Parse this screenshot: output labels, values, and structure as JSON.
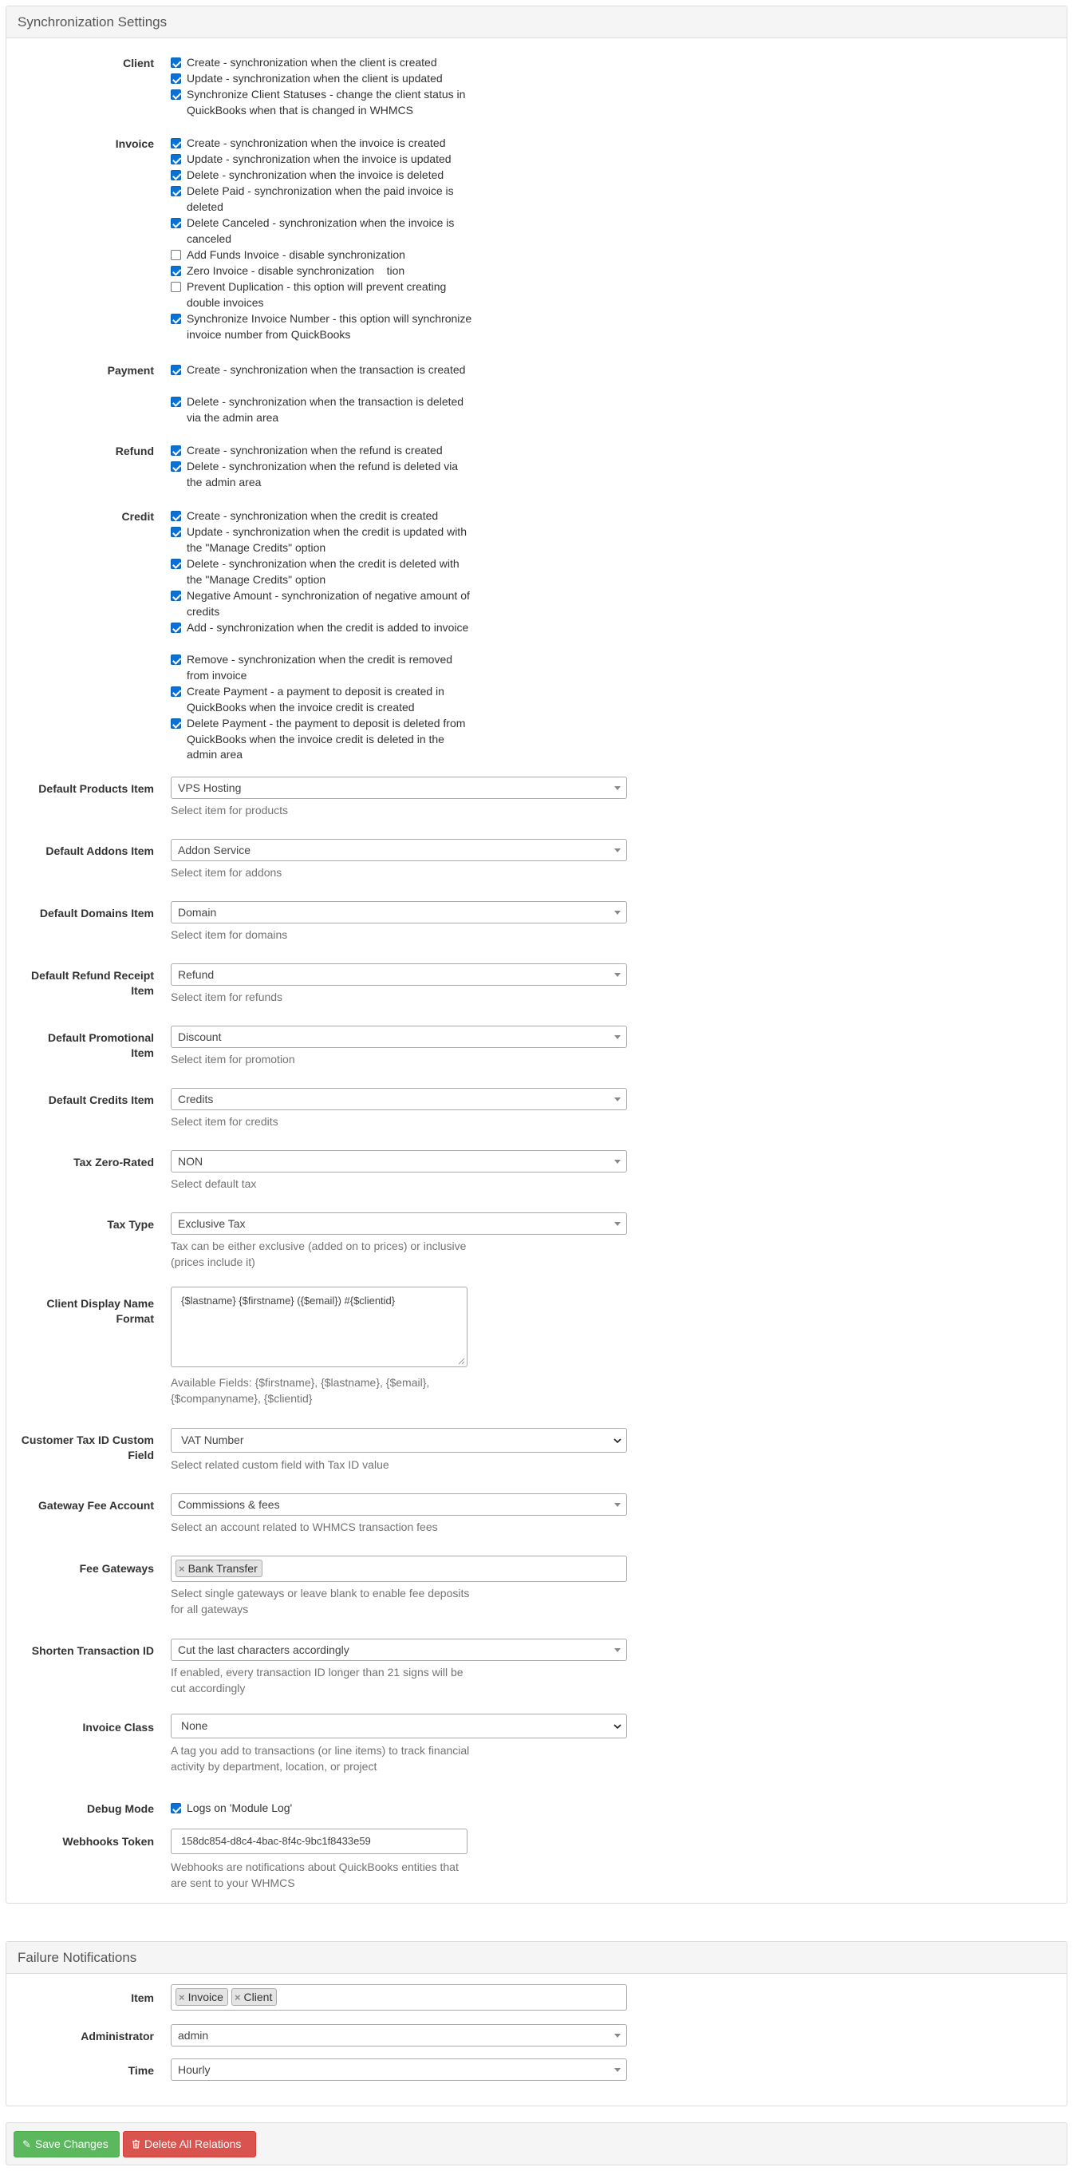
{
  "sync": {
    "title": "Synchronization Settings",
    "client": {
      "label": "Client",
      "items": [
        {
          "text": "Create - synchronization when the client is created",
          "checked": true
        },
        {
          "text": "Update - synchronization when the client is updated",
          "checked": true
        },
        {
          "text": "Synchronize Client Statuses - change the client status in QuickBooks when that is changed in WHMCS",
          "checked": true
        }
      ]
    },
    "invoice": {
      "label": "Invoice",
      "items": [
        {
          "text": "Create - synchronization when the invoice is created",
          "checked": true
        },
        {
          "text": "Update - synchronization when the invoice is updated",
          "checked": true
        },
        {
          "text": "Delete - synchronization when the invoice is deleted",
          "checked": true
        },
        {
          "text": "Delete Paid - synchronization when the paid invoice is deleted",
          "checked": true
        },
        {
          "text": "Delete Canceled - synchronization when the invoice is canceled",
          "checked": true
        },
        {
          "text": "Add Funds Invoice - disable synchronization",
          "checked": false
        },
        {
          "text": "Zero Invoice - disable synchronization    tion",
          "checked": true
        },
        {
          "text": "Prevent Duplication - this option will prevent creating double invoices",
          "checked": false
        },
        {
          "text": "Synchronize Invoice Number - this option will synchronize invoice number from QuickBooks",
          "checked": true
        }
      ]
    },
    "payment": {
      "label": "Payment",
      "items": [
        {
          "text": "Create - synchronization when the transaction is created",
          "checked": true
        },
        {
          "text": "Delete - synchronization when the transaction is deleted via the admin area",
          "checked": true
        }
      ]
    },
    "refund": {
      "label": "Refund",
      "items": [
        {
          "text": "Create - synchronization when the refund is created",
          "checked": true
        },
        {
          "text": "Delete - synchronization when the refund is deleted via the admin area",
          "checked": true
        }
      ]
    },
    "credit": {
      "label": "Credit",
      "items": [
        {
          "text": "Create - synchronization when the credit is created",
          "checked": true
        },
        {
          "text": "Update - synchronization when the credit is updated with the \"Manage Credits\" option",
          "checked": true
        },
        {
          "text": "Delete - synchronization when the credit is deleted with the \"Manage Credits\" option",
          "checked": true
        },
        {
          "text": "Negative Amount - synchronization of negative amount of credits",
          "checked": true
        },
        {
          "text": "Add - synchronization when the credit is added to invoice",
          "checked": true
        },
        {
          "text": "Remove - synchronization when the credit is removed from invoice",
          "checked": true
        },
        {
          "text": "Create Payment - a payment to deposit is created in QuickBooks when the invoice credit is created",
          "checked": true
        },
        {
          "text": "Delete Payment - the payment to deposit is deleted from QuickBooks when the invoice credit is deleted in the admin area",
          "checked": true
        }
      ]
    },
    "default_products": {
      "label": "Default Products Item",
      "value": "VPS Hosting",
      "help": "Select item for products"
    },
    "default_addons": {
      "label": "Default Addons Item",
      "value": "Addon Service",
      "help": "Select item for addons"
    },
    "default_domains": {
      "label": "Default Domains Item",
      "value": "Domain",
      "help": "Select item for domains"
    },
    "default_refund": {
      "label_1": "Default Refund Receipt",
      "label_2": "Item",
      "value": "Refund",
      "help": "Select item for refunds"
    },
    "default_promotional": {
      "label_1": "Default Promotional",
      "label_2": "Item",
      "value": "Discount",
      "help": "Select item for promotion"
    },
    "default_credits": {
      "label": "Default Credits Item",
      "value": "Credits",
      "help": "Select item for credits"
    },
    "tax_zero": {
      "label": "Tax Zero-Rated",
      "value": "NON",
      "help": "Select default tax"
    },
    "tax_type": {
      "label": "Tax Type",
      "value": "Exclusive Tax",
      "help": "Tax can be either exclusive (added on to prices) or inclusive (prices include it)"
    },
    "display_name": {
      "label_1": "Client Display Name",
      "label_2": "Format",
      "value": "{$lastname} {$firstname} ({$email}) #{$clientid}",
      "help": "Available Fields: {$firstname}, {$lastname}, {$email}, {$companyname}, {$clientid}"
    },
    "customer_tax": {
      "label_1": "Customer Tax ID Custom",
      "label_2": "Field",
      "value": "VAT Number",
      "help": "Select related custom field with Tax ID value"
    },
    "gateway_fee": {
      "label": "Gateway Fee Account",
      "value": "Commissions & fees",
      "help": "Select an account related to WHMCS transaction fees"
    },
    "fee_gateways": {
      "label": "Fee Gateways",
      "tags": [
        "Bank Transfer"
      ],
      "help": "Select single gateways or leave blank to enable fee deposits for all gateways"
    },
    "shorten_tx": {
      "label": "Shorten Transaction ID",
      "value": "Cut the last characters accordingly",
      "help": "If enabled, every transaction ID longer than 21 signs will be cut accordingly"
    },
    "invoice_class": {
      "label": "Invoice Class",
      "value": "None",
      "help": "A tag you add to transactions (or line items) to track financial activity by department, location, or project"
    },
    "debug": {
      "label": "Debug Mode",
      "text": "Logs on 'Module Log'",
      "checked": true
    },
    "webhooks": {
      "label": "Webhooks Token",
      "value": "158dc854-d8c4-4bac-8f4c-9bc1f8433e59",
      "help": "Webhooks are notifications about QuickBooks entities that are sent to your WHMCS"
    }
  },
  "failure": {
    "title": "Failure Notifications",
    "item": {
      "label": "Item",
      "tags": [
        "Invoice",
        "Client"
      ]
    },
    "administrator": {
      "label": "Administrator",
      "value": "admin"
    },
    "time": {
      "label": "Time",
      "value": "Hourly"
    }
  },
  "actions": {
    "save_label": "Save Changes",
    "delete_label": "Delete All Relations"
  },
  "colors": {
    "primary_checkbox": "#0a72d4",
    "save_button": "#5cb85c",
    "delete_button": "#d9534f"
  }
}
